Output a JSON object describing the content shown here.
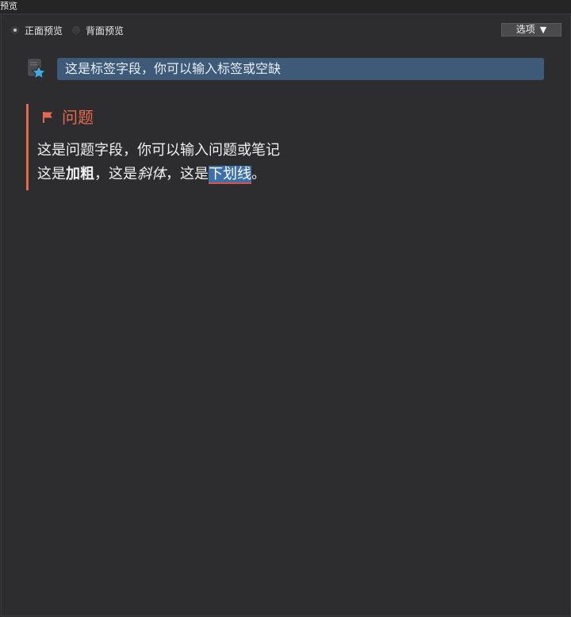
{
  "window": {
    "title": "预览"
  },
  "toolbar": {
    "front_label": "正面预览",
    "back_label": "背面预览",
    "selected": "front",
    "options_label": "选项",
    "options_arrow": "▼"
  },
  "tag": {
    "icon": "anki-star-card-icon",
    "text": "这是标签字段，你可以输入标签或空缺"
  },
  "question": {
    "icon": "flag-icon",
    "heading": "问题",
    "line1": "这是问题字段，你可以输入问题或笔记",
    "line2": {
      "prefix": "这是",
      "bold": "加粗",
      "sep1": "，这是",
      "italic": "斜体",
      "sep2": "，这是",
      "underline": "下划线",
      "suffix": "。"
    }
  },
  "colors": {
    "background": "#2d2d30",
    "tag_field": "#3d5a78",
    "accent": "#e5694e",
    "underline_highlight": "#3d6fa8"
  }
}
